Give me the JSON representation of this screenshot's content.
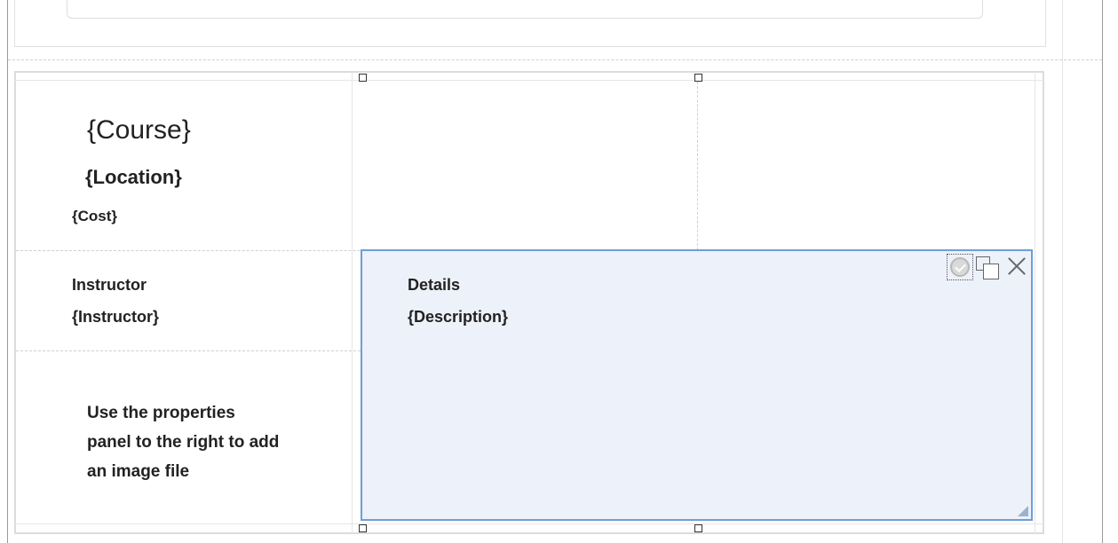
{
  "template": {
    "course": "{Course}",
    "location": "{Location}",
    "cost": "{Cost}",
    "instructor_heading": "Instructor",
    "instructor_value": "{Instructor}",
    "details_heading": "Details",
    "details_value": "{Description}",
    "image_note_line1": "Use the properties",
    "image_note_line2": "panel to the right to add",
    "image_note_line3": "an image file"
  },
  "cell_toolbar": {
    "icons": [
      "check-circle-icon",
      "duplicate-icon",
      "close-icon"
    ]
  },
  "colors": {
    "selection_border": "#6d9fd9",
    "selection_fill": "#edf1f9"
  }
}
